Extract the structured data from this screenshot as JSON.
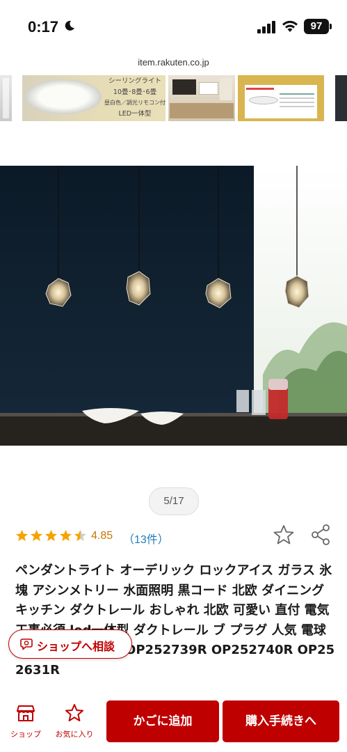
{
  "status_bar": {
    "time": "0:17",
    "battery": "97"
  },
  "browser": {
    "url": "item.rakuten.co.jp"
  },
  "thumbnail_strip": {
    "thumb2_lines": [
      "シーリングライト",
      "10畳･8畳･6畳",
      "昼白色／調光リモコン付",
      "LED一体型"
    ]
  },
  "gallery": {
    "pager": "5/17"
  },
  "rating": {
    "score": "4.85",
    "reviews": "（13件）",
    "stars_value": 4.5,
    "stars_max": 5
  },
  "product": {
    "title": "ペンダントライト オーデリック ロックアイス ガラス 氷 塊 アシンメトリー 水面照明 黒コード 北欧 ダイニング キッチン ダクトレール おしゃれ 北欧 可愛い 直付 電気工事必須 led一体型 ダクトレール ブ プラグ 人気 電球色 led電球 正規品 OP252739R OP252740R OP252631R"
  },
  "consult_button": {
    "label": "ショップへ相談"
  },
  "bottom_bar": {
    "shop_label": "ショップ",
    "favorite_label": "お気に入り",
    "cart_label": "かごに追加",
    "buy_label": "購入手続きへ"
  },
  "colors": {
    "brand_red": "#bf0000",
    "star": "#f5a300",
    "rating_text": "#c77700",
    "review_link": "#1f7bb8"
  },
  "icons": [
    "moon-icon",
    "signal-icon",
    "wifi-icon",
    "battery-icon",
    "star-icon",
    "share-icon",
    "chat-icon",
    "shop-icon"
  ]
}
